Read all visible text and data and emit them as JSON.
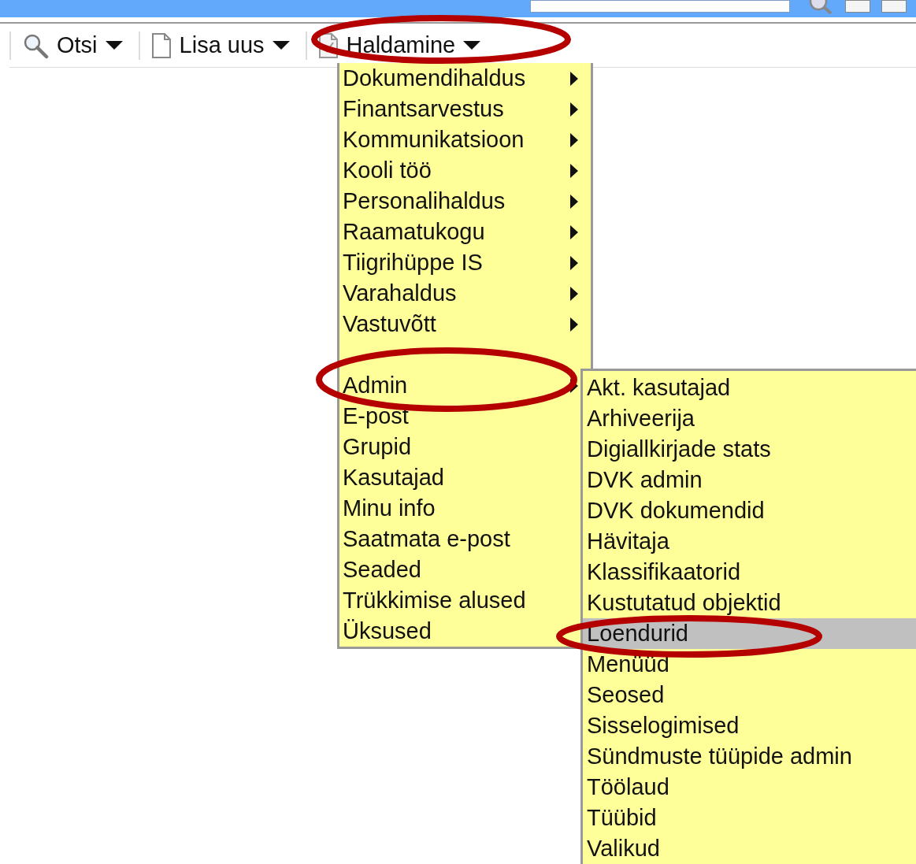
{
  "toolbar": [
    {
      "label": "Otsi"
    },
    {
      "label": "Lisa uus"
    },
    {
      "label": "Haldamine"
    }
  ],
  "menu": [
    {
      "kind": "item",
      "label": "Dokumendihaldus",
      "submenu": true
    },
    {
      "kind": "item",
      "label": "Finantsarvestus",
      "submenu": true
    },
    {
      "kind": "item",
      "label": "Kommunikatsioon",
      "submenu": true
    },
    {
      "kind": "item",
      "label": "Kooli töö",
      "submenu": true
    },
    {
      "kind": "item",
      "label": "Personalihaldus",
      "submenu": true
    },
    {
      "kind": "item",
      "label": "Raamatukogu",
      "submenu": true
    },
    {
      "kind": "item",
      "label": "Tiigrihüppe IS",
      "submenu": true
    },
    {
      "kind": "item",
      "label": "Varahaldus",
      "submenu": true
    },
    {
      "kind": "item",
      "label": "Vastuvõtt",
      "submenu": true
    },
    {
      "kind": "covered"
    },
    {
      "kind": "item",
      "label": "Admin",
      "submenu": true
    },
    {
      "kind": "item",
      "label": "E-post",
      "submenu": false
    },
    {
      "kind": "item",
      "label": "Grupid",
      "submenu": false
    },
    {
      "kind": "item",
      "label": "Kasutajad",
      "submenu": false
    },
    {
      "kind": "item",
      "label": "Minu info",
      "submenu": false
    },
    {
      "kind": "item",
      "label": "Saatmata e-post",
      "submenu": false
    },
    {
      "kind": "item",
      "label": "Seaded",
      "submenu": false
    },
    {
      "kind": "item",
      "label": "Trükkimise alused",
      "submenu": false
    },
    {
      "kind": "item",
      "label": "Üksused",
      "submenu": false
    }
  ],
  "submenu": [
    {
      "label": "Akt. kasutajad",
      "selected": false
    },
    {
      "label": "Arhiveerija",
      "selected": false
    },
    {
      "label": "Digiallkirjade stats",
      "selected": false
    },
    {
      "label": "DVK admin",
      "selected": false
    },
    {
      "label": "DVK dokumendid",
      "selected": false
    },
    {
      "label": "Hävitaja",
      "selected": false
    },
    {
      "label": "Klassifikaatorid",
      "selected": false
    },
    {
      "label": "Kustutatud objektid",
      "selected": false
    },
    {
      "label": "Loendurid",
      "selected": true
    },
    {
      "label": "Menüüd",
      "selected": false
    },
    {
      "label": "Seosed",
      "selected": false
    },
    {
      "label": "Sisselogimised",
      "selected": false
    },
    {
      "label": "Sündmuste tüüpide admin",
      "selected": false
    },
    {
      "label": "Töölaud",
      "selected": false
    },
    {
      "label": "Tüübid",
      "selected": false
    },
    {
      "label": "Valikud",
      "selected": false
    }
  ]
}
